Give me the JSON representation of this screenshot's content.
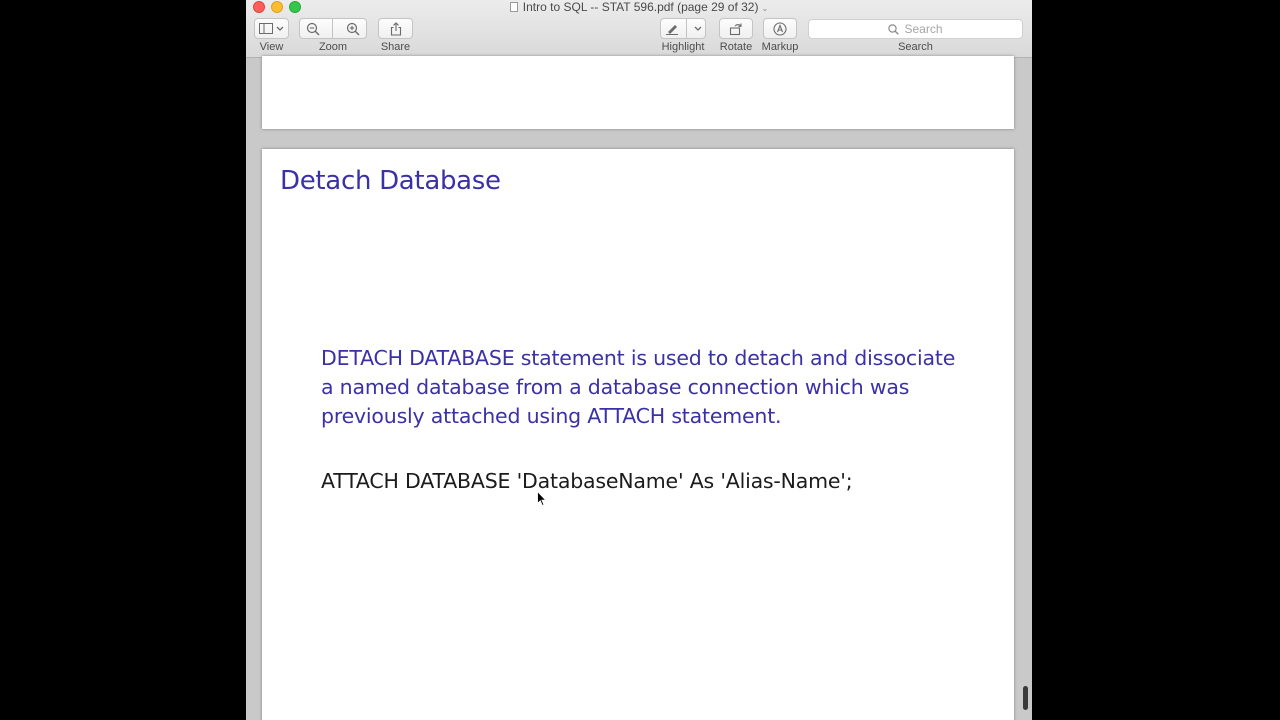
{
  "window": {
    "title": "Intro to SQL -- STAT 596.pdf (page 29 of 32)"
  },
  "toolbar": {
    "view_label": "View",
    "zoom_label": "Zoom",
    "share_label": "Share",
    "highlight_label": "Highlight",
    "rotate_label": "Rotate",
    "markup_label": "Markup",
    "search_placeholder": "Search",
    "search_label": "Search"
  },
  "slide": {
    "title": "Detach Database",
    "body": "DETACH DATABASE statement is used to detach and dissociate a named database from a database connection which was previously attached using ATTACH statement.",
    "code": "ATTACH DATABASE 'DatabaseName' As 'Alias-Name';"
  },
  "colors": {
    "slide_title": "#3a31a8",
    "slide_body": "#3a31a8",
    "code": "#1b1b1b"
  },
  "icons": [
    "sidebar-icon",
    "zoom-out-icon",
    "zoom-in-icon",
    "share-icon",
    "pen-icon",
    "rotate-icon",
    "markup-icon",
    "search-icon"
  ]
}
